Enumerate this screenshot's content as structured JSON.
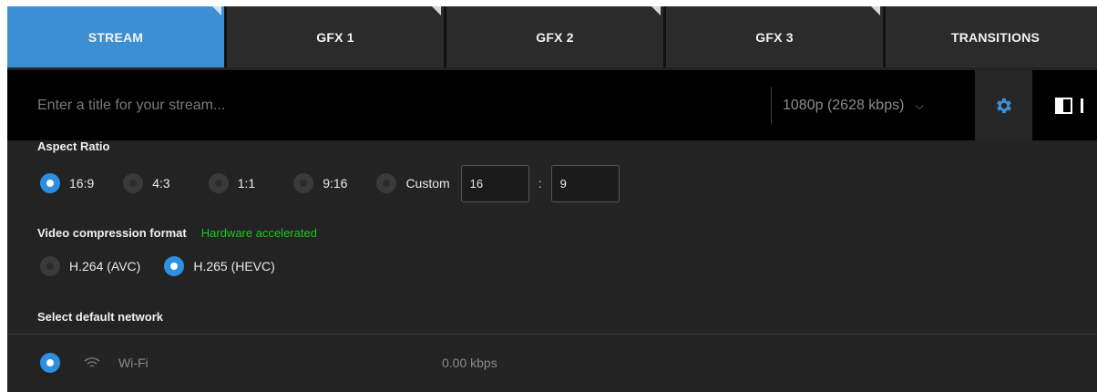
{
  "tabs": [
    {
      "label": "STREAM",
      "active": true
    },
    {
      "label": "GFX 1",
      "active": false
    },
    {
      "label": "GFX 2",
      "active": false
    },
    {
      "label": "GFX 3",
      "active": false
    },
    {
      "label": "TRANSITIONS",
      "active": false
    }
  ],
  "titlebar": {
    "title_placeholder": "Enter a title for your stream...",
    "title_value": "",
    "quality": "1080p (2628 kbps)"
  },
  "aspect_ratio": {
    "heading": "Aspect Ratio",
    "options": [
      {
        "label": "16:9",
        "selected": true
      },
      {
        "label": "4:3",
        "selected": false
      },
      {
        "label": "1:1",
        "selected": false
      },
      {
        "label": "9:16",
        "selected": false
      },
      {
        "label": "Custom",
        "selected": false
      }
    ],
    "custom_width": "16",
    "custom_separator": ":",
    "custom_height": "9"
  },
  "compression": {
    "heading": "Video compression format",
    "badge": "Hardware accelerated",
    "options": [
      {
        "label": "H.264 (AVC)",
        "selected": false
      },
      {
        "label": "H.265 (HEVC)",
        "selected": true
      }
    ]
  },
  "network": {
    "heading": "Select default network",
    "items": [
      {
        "name": "Wi-Fi",
        "rate": "0.00 kbps",
        "selected": true
      }
    ]
  },
  "colors": {
    "accent": "#3d8fd3",
    "radio_on": "#2d8fe0",
    "hardware_badge": "#19c819",
    "background": "#232323"
  }
}
